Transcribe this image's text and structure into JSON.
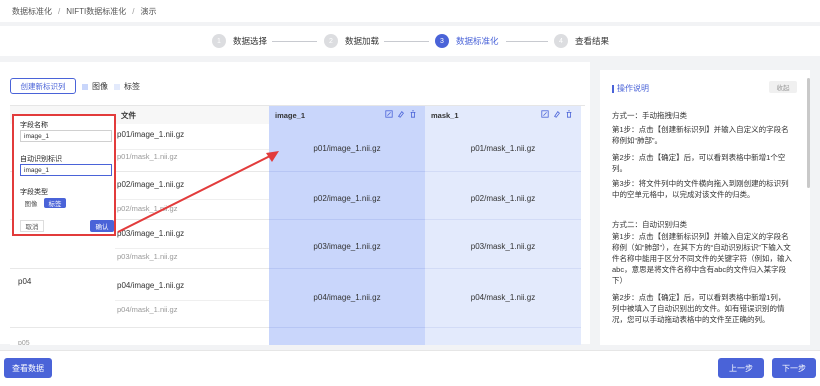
{
  "breadcrumb": {
    "items": [
      "数据标准化",
      "NIFTI数据标准化",
      "演示"
    ]
  },
  "steps": [
    {
      "num": "1",
      "label": "数据选择"
    },
    {
      "num": "2",
      "label": "数据加载"
    },
    {
      "num": "3",
      "label": "数据标准化"
    },
    {
      "num": "4",
      "label": "查看结果"
    }
  ],
  "toolbar": {
    "create_label": "创建新标识列",
    "legend_image": "图像",
    "legend_tag": "标签"
  },
  "table": {
    "file_header": "文件",
    "col1_header": "image_1",
    "col2_header": "mask_1",
    "rows": [
      {
        "id": "",
        "file1": "p01/image_1.nii.gz",
        "file2": "p01/mask_1.nii.gz",
        "col1": "p01/image_1.nii.gz",
        "col2": "p01/mask_1.nii.gz"
      },
      {
        "id": "",
        "file1": "p02/image_1.nii.gz",
        "file2": "p02/mask_1.nii.gz",
        "col1": "p02/image_1.nii.gz",
        "col2": "p02/mask_1.nii.gz"
      },
      {
        "id": "",
        "file1": "p03/image_1.nii.gz",
        "file2": "p03/mask_1.nii.gz",
        "col1": "p03/image_1.nii.gz",
        "col2": "p03/mask_1.nii.gz"
      },
      {
        "id": "p04",
        "file1": "p04/image_1.nii.gz",
        "file2": "p04/mask_1.nii.gz",
        "col1": "p04/image_1.nii.gz",
        "col2": "p04/mask_1.nii.gz"
      }
    ],
    "partial_next": "p05"
  },
  "popup": {
    "field_name_label": "字段名称",
    "field_name_value": "image_1",
    "auto_label": "自动识别标识",
    "auto_value": "image_1",
    "type_label": "字段类型",
    "type_options": [
      "图像",
      "标签"
    ],
    "cancel": "取消",
    "confirm": "确认"
  },
  "right_panel": {
    "title": "操作说明",
    "collapse": "收起",
    "p1": "方式一：手动拖拽归类",
    "p2": "第1步：点击【创建新标识列】并输入自定义的字段名称例如“肺部”。",
    "p3": "第2步：点击【确定】后，可以看到表格中新增1个空列。",
    "p4": "第3步：将文件列中的文件横向拖入到刚创建的标识列中的空单元格中，以完成对该文件的归类。",
    "p5": "方式二：自动识别归类",
    "p6": "第1步：点击【创建新标识列】并输入自定义的字段名称例（如“肺部”），在其下方的“自动识别标识”下输入文件名称中能用于区分不同文件的关键字符（例如，输入abc，意思是将文件名称中含有abc的文件归入某字段下）",
    "p7": "第2步：点击【确定】后，可以看到表格中新增1列，列中被填入了自动识别出的文件。如有错误识别的情况，您可以手动拖动表格中的文件至正确的列。"
  },
  "footer": {
    "view_data": "查看数据",
    "prev": "上一步",
    "next": "下一步"
  },
  "colors": {
    "accent": "#4a63d8",
    "image_col": "#c9d6fb",
    "mask_col": "#e3eafc",
    "highlight": "#e23b3b"
  }
}
